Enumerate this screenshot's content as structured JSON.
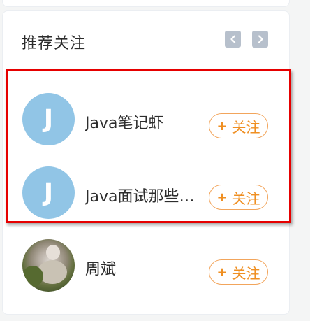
{
  "panel": {
    "title": "推荐关注",
    "prev_icon": "chevron-left-icon",
    "next_icon": "chevron-right-icon"
  },
  "follow_label": "关注",
  "users": [
    {
      "avatar_letter": "J",
      "name": "Java笔记虾",
      "follow": "关注"
    },
    {
      "avatar_letter": "J",
      "name": "Java面试那些…",
      "follow": "关注"
    },
    {
      "avatar_letter": "",
      "name": "周斌",
      "follow": "关注"
    }
  ],
  "colors": {
    "accent": "#ef8f22",
    "avatar_bg": "#91c5e6",
    "highlight": "#e60000"
  }
}
